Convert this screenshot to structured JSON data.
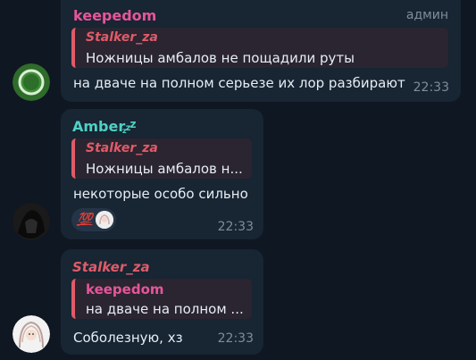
{
  "colors": {
    "background": "#0f1722",
    "bubble": "#182533",
    "reply_bg": "#2a2530",
    "reply_bar": "#e05b69",
    "keepedom": "#e6559a",
    "amber": "#4fd1c5",
    "stalker": "#e05b69"
  },
  "messages": [
    {
      "sender": "keepedom",
      "role": "админ",
      "reply_author": "Stalker_za",
      "reply_text": "Ножницы амбалов не пощадили руты",
      "text": "на дваче на полном серьезе их лор разбирают",
      "time": "22:33"
    },
    {
      "sender": "Amber",
      "status_icon": "zzz-icon",
      "reply_author": "Stalker_za",
      "reply_text": "Ножницы амбалов н...",
      "text": "некоторые особо сильно",
      "reaction": "💯",
      "time": "22:33"
    },
    {
      "sender": "Stalker_za",
      "reply_author": "keepedom",
      "reply_text": "на дваче на полном ...",
      "text": "Соболезную, хз",
      "time": "22:33"
    }
  ]
}
